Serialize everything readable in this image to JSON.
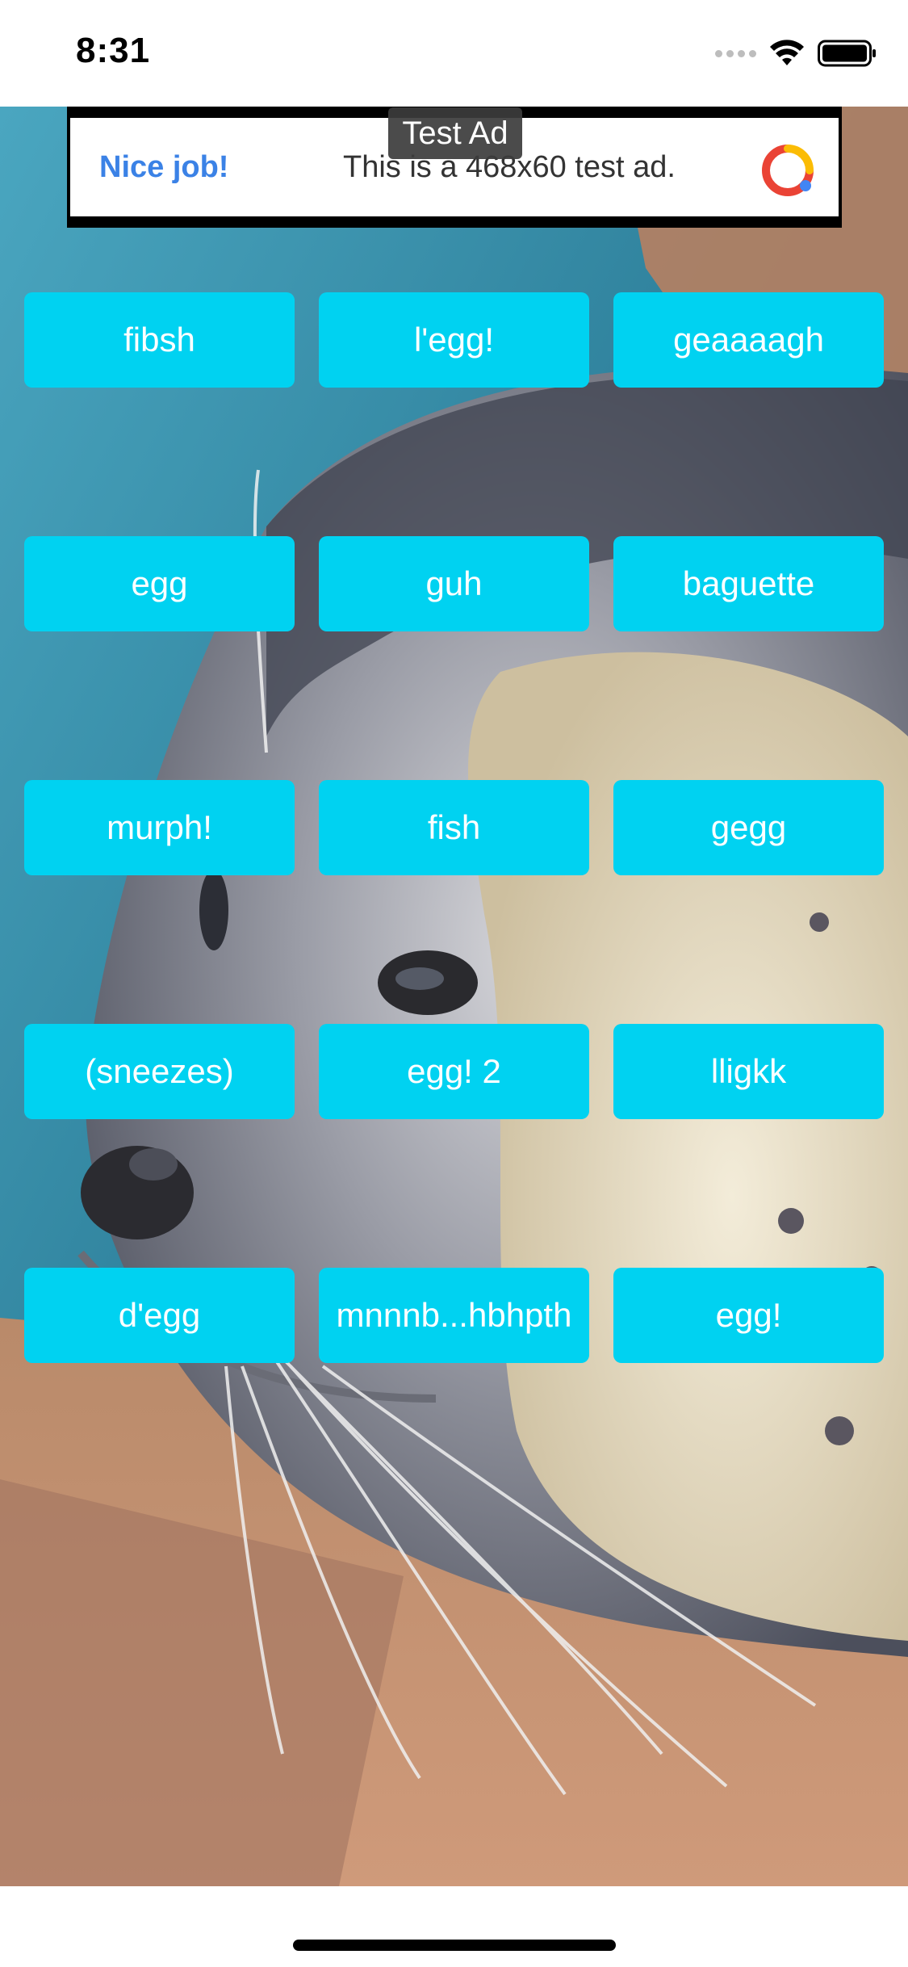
{
  "status_bar": {
    "time": "8:31"
  },
  "ad": {
    "tag": "Test Ad",
    "headline": "Nice job!",
    "body": "This is a 468x60 test ad."
  },
  "buttons": [
    "fibsh",
    "l'egg!",
    "geaaaagh",
    "egg",
    "guh",
    "baguette",
    "murph!",
    "fish",
    "gegg",
    "(sneezes)",
    "egg! 2",
    "lligkk",
    "d'egg",
    "mnnnb...hbhpth",
    "egg!"
  ],
  "colors": {
    "button_bg": "#00d2f1",
    "ad_headline": "#3b82e6"
  }
}
